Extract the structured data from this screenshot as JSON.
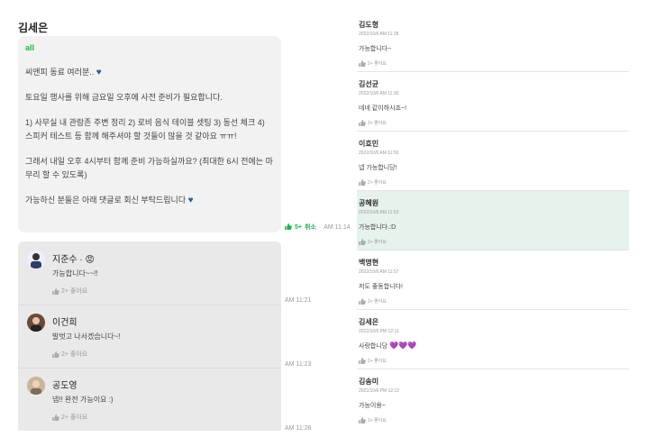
{
  "post": {
    "author": "김세은",
    "mention": "all",
    "lines": [
      "씨앤피 동료 여러분..",
      "토요일 행사를 위해 금요일 오후에 사전 준비가 필요합니다.",
      "1) 사무실 내 관람존 주변 정리 2) 로비 음식 테이블 셋팅 3) 동선 체크 4) 스피커 테스트 등 함께 해주셔야 할 것들이 많을 것 같아요 ㅠㅠ!",
      "그래서 내일 오후 4시부터 함께 준비 가능하실까요? (최대한 6시 전에는 마무리 할 수 있도록)",
      "가능하신 분들은 아래 댓글로 회신 부탁드립니다"
    ],
    "heart_icon": "blue-heart-icon",
    "reaction": {
      "count": "5+",
      "cancel": "취소",
      "sep": "·",
      "time": "AM 11:14"
    }
  },
  "thread": [
    {
      "name": "지준수 · 😡",
      "text": "가능합니다~~!!",
      "like": "2+ 좋아요",
      "time": "AM 11:21"
    },
    {
      "name": "이건희",
      "text": "발벗고 나서겠습니다~!",
      "like": "2+ 좋아요",
      "time": "AM 11:23"
    },
    {
      "name": "공도영",
      "text": "넵!! 완전 가능이요 :)",
      "like": "2+ 좋아요",
      "time": "AM 11:26"
    }
  ],
  "list": [
    {
      "name": "김도형",
      "date": "2022/10/6 AM 11:28",
      "text": "가능합니다~",
      "like": "2+ 좋아요",
      "highlight": false
    },
    {
      "name": "김선균",
      "date": "2022/10/6 AM 11:30",
      "text": "네네 같이하시죠~!",
      "like": "2+ 좋아요",
      "highlight": false
    },
    {
      "name": "이효민",
      "date": "2022/10/6 AM 11:50",
      "text": "넵 가능합니당!",
      "like": "2+ 좋아요",
      "highlight": false
    },
    {
      "name": "공혜원",
      "date": "2022/10/6 AM 11:53",
      "text": "가능합니다.:D",
      "like": "2+ 좋아요",
      "highlight": true
    },
    {
      "name": "백명현",
      "date": "2022/10/6 AM 11:57",
      "text": "저도 좋동합니다!",
      "like": "2+ 좋아요",
      "highlight": false
    },
    {
      "name": "김세은",
      "date": "2022/10/6 PM 12:11",
      "text": "사랑합니당",
      "like": "2+ 좋아요",
      "highlight": false,
      "hearts": "💜💜💜"
    },
    {
      "name": "김송미",
      "date": "2022/10/6 PM 12:12",
      "text": "가능이용~",
      "like": "2+ 좋아요",
      "highlight": false
    }
  ],
  "colors": {
    "accent": "#18b64a",
    "highlight_bg": "#e6f2ec",
    "bubble_bg": "#f2f2f2"
  }
}
